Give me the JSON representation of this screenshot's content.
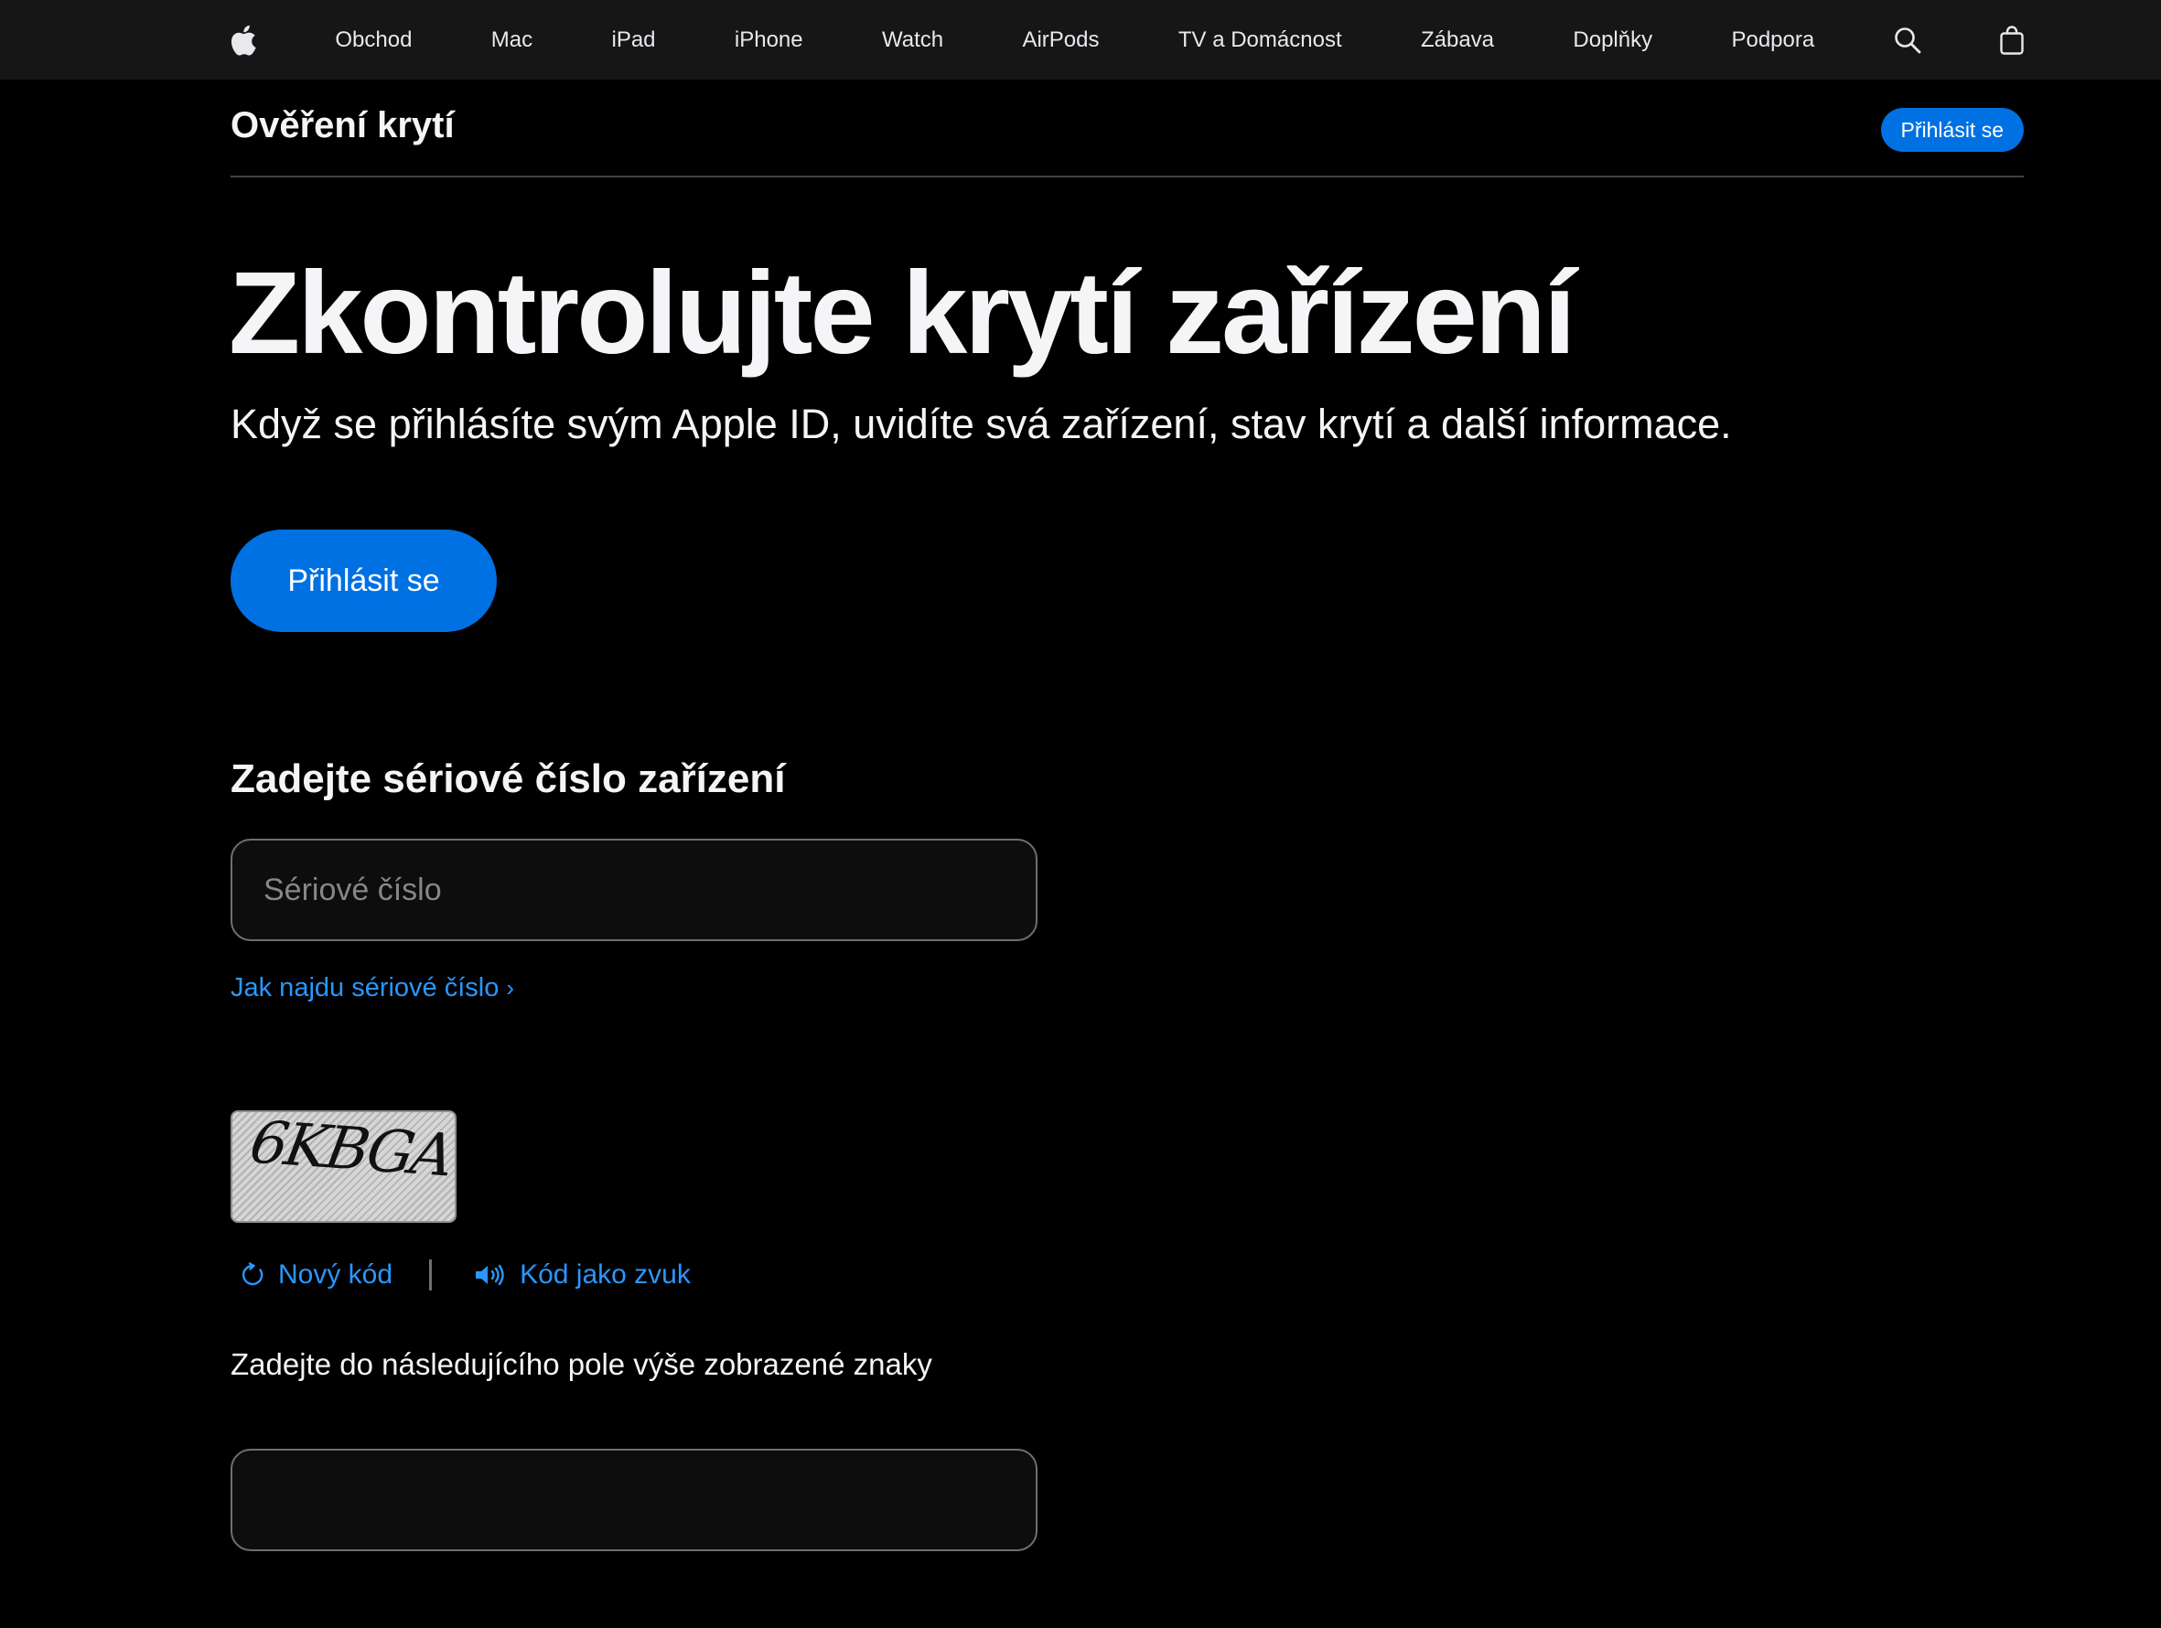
{
  "globalnav": {
    "logo_icon": "apple-logo-icon",
    "items": [
      {
        "label": "Obchod"
      },
      {
        "label": "Mac"
      },
      {
        "label": "iPad"
      },
      {
        "label": "iPhone"
      },
      {
        "label": "Watch"
      },
      {
        "label": "AirPods"
      },
      {
        "label": "TV a Domácnost"
      },
      {
        "label": "Zábava"
      },
      {
        "label": "Doplňky"
      },
      {
        "label": "Podpora"
      }
    ],
    "search_icon": "search-icon",
    "bag_icon": "bag-icon"
  },
  "subnav": {
    "title": "Ověření krytí",
    "signin_label": "Přihlásit se"
  },
  "hero": {
    "title": "Zkontrolujte krytí zařízení",
    "subtitle": "Když se přihlásíte svým Apple ID, uvidíte svá zařízení, stav krytí a další informace.",
    "signin_label": "Přihlásit se"
  },
  "serial": {
    "heading": "Zadejte sériové číslo zařízení",
    "placeholder": "Sériové číslo",
    "value": "",
    "help_link": "Jak najdu sériové číslo",
    "help_chevron": "›"
  },
  "captcha": {
    "image_text": "6KBGA",
    "new_code_label": "Nový kód",
    "new_code_icon": "refresh-icon",
    "audio_label": "Kód jako zvuk",
    "audio_icon": "speaker-icon",
    "instruction": "Zadejte do následujícího pole výše zobrazené znaky",
    "value": ""
  },
  "colors": {
    "background": "#000000",
    "nav_background": "#161617",
    "accent": "#0071e3",
    "link": "#2997ff",
    "text": "#f5f5f7"
  }
}
